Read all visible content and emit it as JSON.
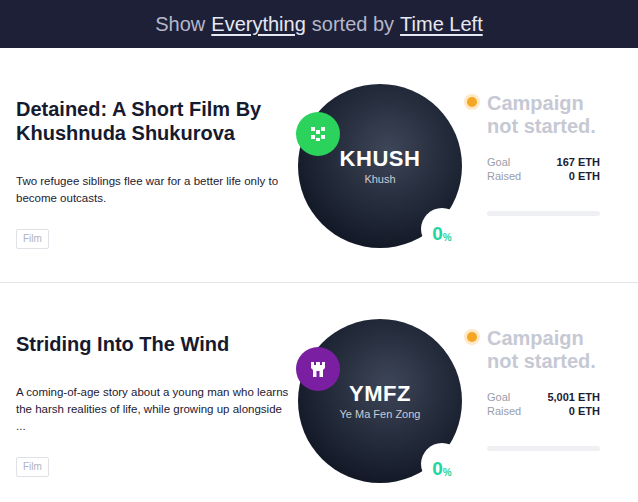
{
  "header": {
    "prefix": "Show",
    "filter": "Everything",
    "middle": "sorted by",
    "sort": "Time Left"
  },
  "campaigns": [
    {
      "title": "Detained: A Short Film By Khushnuda Shukurova",
      "description": "Two refugee siblings flee war for a better life only to become outcasts.",
      "tag": "Film",
      "creator_code": "KHUSH",
      "creator_name": "Khush",
      "badge_kind": "pixel",
      "color": "#2bd25b",
      "percent": "0",
      "percent_sign": "%",
      "status": "Campaign not started.",
      "goal_label": "Goal",
      "goal": "167 ETH",
      "raised_label": "Raised",
      "raised": "0 ETH",
      "level": 0
    },
    {
      "title": "Striding Into The Wind",
      "description": "A coming-of-age story about a young man who learns the harsh realities of life, while growing up alongside ...",
      "tag": "Film",
      "creator_code": "YMFZ",
      "creator_name": "Ye Ma Fen Zong",
      "badge_kind": "tower",
      "color": "#7b1fa2",
      "percent": "0",
      "percent_sign": "%",
      "status": "Campaign not started.",
      "goal_label": "Goal",
      "goal": "5,001 ETH",
      "raised_label": "Raised",
      "raised": "0 ETH",
      "level": 0
    }
  ]
}
